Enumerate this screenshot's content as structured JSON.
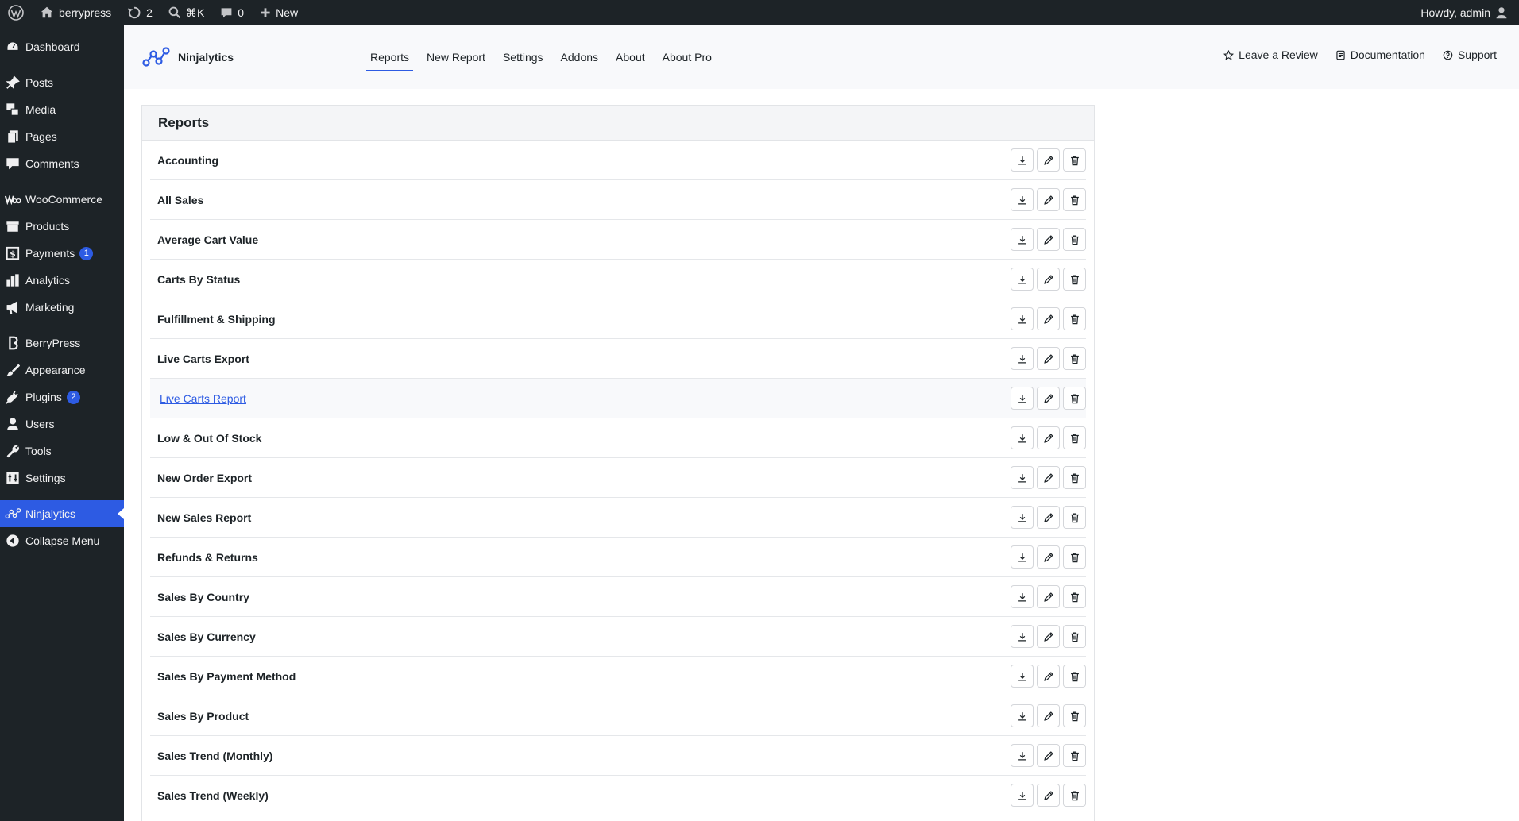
{
  "adminbar": {
    "site_name": "berrypress",
    "updates_count": "2",
    "search_shortcut": "⌘K",
    "comments_count": "0",
    "new_label": "New",
    "howdy": "Howdy, admin"
  },
  "sidebar": {
    "items": [
      {
        "label": "Dashboard",
        "icon": "dashboard-icon"
      },
      {
        "label": "Posts",
        "icon": "pin-icon"
      },
      {
        "label": "Media",
        "icon": "media-icon"
      },
      {
        "label": "Pages",
        "icon": "pages-icon"
      },
      {
        "label": "Comments",
        "icon": "comment-icon"
      },
      {
        "label": "WooCommerce",
        "icon": "woo-icon"
      },
      {
        "label": "Products",
        "icon": "archive-icon"
      },
      {
        "label": "Payments",
        "icon": "dollar-icon",
        "badge": "1"
      },
      {
        "label": "Analytics",
        "icon": "bar-chart-icon"
      },
      {
        "label": "Marketing",
        "icon": "megaphone-icon"
      },
      {
        "label": "BerryPress",
        "icon": "berrypress-icon"
      },
      {
        "label": "Appearance",
        "icon": "brush-icon"
      },
      {
        "label": "Plugins",
        "icon": "plug-icon",
        "badge": "2"
      },
      {
        "label": "Users",
        "icon": "user-icon"
      },
      {
        "label": "Tools",
        "icon": "wrench-icon"
      },
      {
        "label": "Settings",
        "icon": "settings-icon"
      },
      {
        "label": "Ninjalytics",
        "icon": "ninjalytics-icon",
        "active": true
      },
      {
        "label": "Collapse Menu",
        "icon": "collapse-icon"
      }
    ]
  },
  "topnav": {
    "brand": "Ninjalytics",
    "tabs": [
      "Reports",
      "New Report",
      "Settings",
      "Addons",
      "About",
      "About Pro"
    ],
    "active_tab": "Reports",
    "review_label": "Leave a Review",
    "docs_label": "Documentation",
    "support_label": "Support"
  },
  "reports": {
    "title": "Reports",
    "rows": [
      "Accounting",
      "All Sales",
      "Average Cart Value",
      "Carts By Status",
      "Fulfillment & Shipping",
      "Live Carts Export",
      "Live Carts Report",
      "Low & Out Of Stock",
      "New Order Export",
      "New Sales Report",
      "Refunds & Returns",
      "Sales By Country",
      "Sales By Currency",
      "Sales By Payment Method",
      "Sales By Product",
      "Sales Trend (Monthly)",
      "Sales Trend (Weekly)"
    ],
    "hovered_row": "Live Carts Report"
  },
  "colors": {
    "accent": "#2d5be3",
    "sidebar_bg": "#1d2327"
  }
}
